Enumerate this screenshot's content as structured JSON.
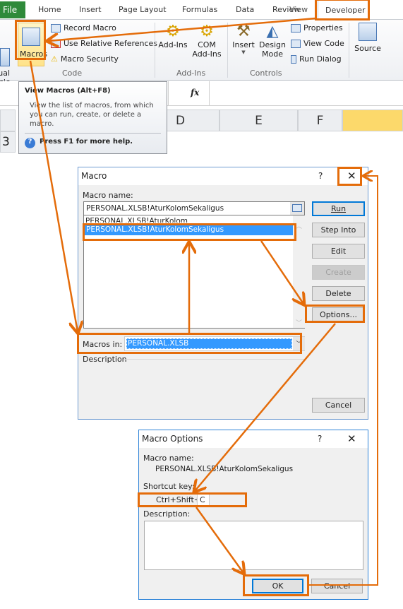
{
  "ribbon": {
    "tabs": [
      "File",
      "Home",
      "Insert",
      "Page Layout",
      "Formulas",
      "Data",
      "Review",
      "View",
      "Developer"
    ],
    "code_group": {
      "label": "Code",
      "visual_basic": "Visual Basic",
      "macros": "Macros",
      "record_macro": "Record Macro",
      "use_relative": "Use Relative References",
      "macro_security": "Macro Security"
    },
    "addins_group": {
      "label": "Add-Ins",
      "addins": "Add-Ins",
      "com_addins": "COM Add-Ins"
    },
    "controls_group": {
      "label": "Controls",
      "insert": "Insert",
      "design_mode": "Design Mode",
      "properties": "Properties",
      "view_code": "View Code",
      "run_dialog": "Run Dialog"
    },
    "xml_group": {
      "source": "Source"
    }
  },
  "formula_bar": {
    "fx": "fx"
  },
  "grid": {
    "columns": [
      "D",
      "E",
      "F"
    ],
    "row": "3"
  },
  "tooltip": {
    "title": "View Macros (Alt+F8)",
    "body": "View the list of macros, from which you can run, create, or delete a macro.",
    "help": "Press F1 for more help."
  },
  "macro_dialog": {
    "title": "Macro",
    "help": "?",
    "close": "✕",
    "name_label": "Macro name:",
    "name_value": "PERSONAL.XLSB!AturKolomSekaligus",
    "list": [
      "PERSONAL.XLSB!AturKolom",
      "PERSONAL.XLSB!AturKolomSekaligus"
    ],
    "selected_index": 1,
    "buttons": {
      "run": "Run",
      "step_into": "Step Into",
      "edit": "Edit",
      "create": "Create",
      "delete": "Delete",
      "options": "Options...",
      "cancel": "Cancel"
    },
    "macros_in_label": "Macros in:",
    "macros_in_value": "PERSONAL.XLSB",
    "description_label": "Description"
  },
  "options_dialog": {
    "title": "Macro Options",
    "help": "?",
    "close": "✕",
    "name_label": "Macro name:",
    "name_value": "PERSONAL.XLSB!AturKolomSekaligus",
    "shortcut_label": "Shortcut key:",
    "shortcut_prefix": "Ctrl+Shift+",
    "shortcut_value": "C",
    "description_label": "Description:",
    "description_value": "",
    "ok": "OK",
    "cancel": "Cancel"
  },
  "colors": {
    "annotation": "#e46c0a",
    "selection": "#3399ff",
    "file_tab": "#2f8a3a"
  }
}
